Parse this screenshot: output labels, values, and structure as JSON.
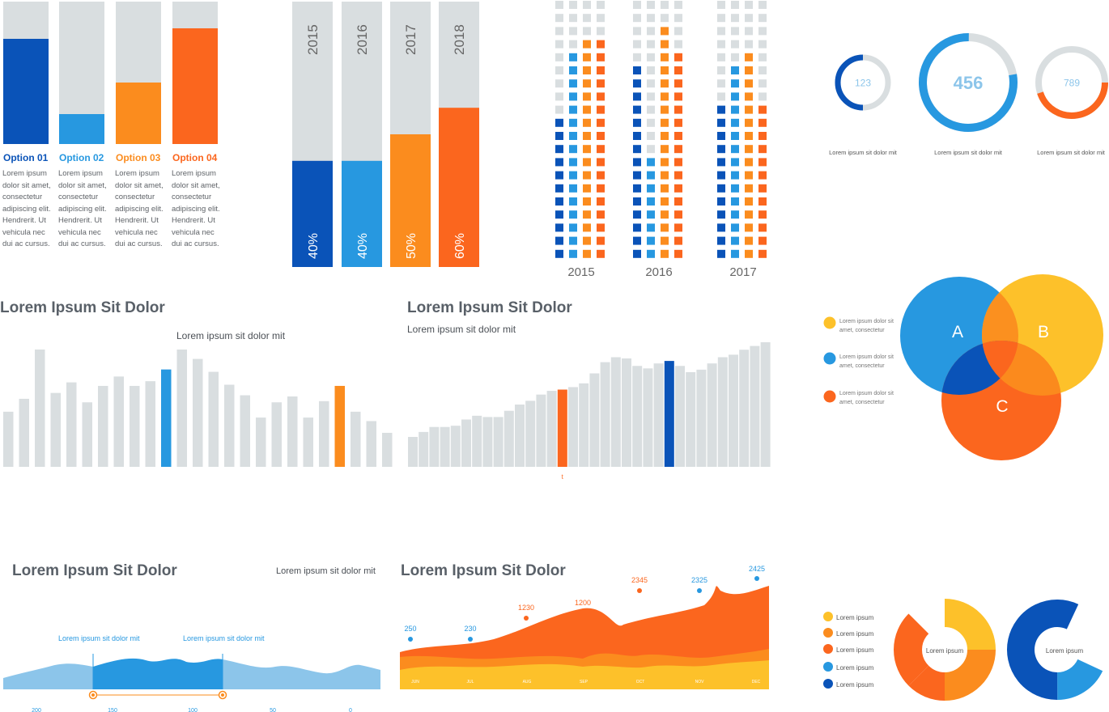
{
  "colors": {
    "dark_blue": "#0a53b8",
    "light_blue": "#2798e0",
    "orange": "#fb8c1e",
    "red_orange": "#fb661e",
    "yellow": "#fdc12a",
    "grey": "#d9dee0",
    "area_light": "#8cc5ea"
  },
  "options": [
    {
      "label": "Option 01",
      "text": "Lorem ipsum dolor sit amet, consectetur adipiscing elit. Hendrerit. Ut vehicula nec dui ac cursus.",
      "value": 0.74,
      "color": "#0a53b8"
    },
    {
      "label": "Option 02",
      "text": "Lorem ipsum dolor sit amet, consectetur adipiscing elit. Hendrerit. Ut vehicula nec dui ac cursus.",
      "value": 0.21,
      "color": "#2798e0"
    },
    {
      "label": "Option 03",
      "text": "Lorem ipsum dolor sit amet, consectetur adipiscing elit. Hendrerit. Ut vehicula nec dui ac cursus.",
      "value": 0.43,
      "color": "#fb8c1e"
    },
    {
      "label": "Option 04",
      "text": "Lorem ipsum dolor sit amet, consectetur adipiscing elit. Hendrerit. Ut vehicula nec dui ac cursus.",
      "value": 0.81,
      "color": "#fb661e"
    }
  ],
  "chart_data": [
    {
      "type": "bar",
      "categories": [
        "2015",
        "2016",
        "2017",
        "2018"
      ],
      "values": [
        40,
        40,
        50,
        60
      ],
      "value_labels": [
        "40%",
        "40%",
        "50%",
        "60%"
      ],
      "colors": [
        "#0a53b8",
        "#2798e0",
        "#fb8c1e",
        "#fb661e"
      ]
    },
    {
      "type": "bar",
      "subtype": "pictogram",
      "categories": [
        "2015",
        "2016",
        "2017"
      ],
      "rows": 20,
      "columns": 4,
      "filled": [
        [
          11,
          16,
          17,
          17
        ],
        [
          15,
          8,
          18,
          16
        ],
        [
          12,
          15,
          16,
          12
        ]
      ],
      "colors": [
        "#0a53b8",
        "#2798e0",
        "#fb8c1e",
        "#fb661e"
      ]
    },
    {
      "type": "pie",
      "subtype": "ring",
      "rings": [
        {
          "value_label": "123",
          "fraction": 0.5,
          "color": "#0a53b8",
          "caption": "Lorem ipsum sit dolor mit"
        },
        {
          "value_label": "456",
          "fraction": 0.78,
          "color": "#2798e0",
          "caption": "Lorem ipsum sit dolor mit"
        },
        {
          "value_label": "789",
          "fraction": 0.45,
          "color": "#fb661e",
          "caption": "Lorem ipsum sit dolor mit"
        }
      ]
    },
    {
      "type": "bar",
      "title": "Lorem Ipsum Sit Dolor",
      "annotation": "Lorem ipsum sit dolor mit",
      "values": [
        0.47,
        0.58,
        1.0,
        0.63,
        0.72,
        0.55,
        0.69,
        0.77,
        0.69,
        0.73,
        0.83,
        1.0,
        0.92,
        0.81,
        0.7,
        0.61,
        0.42,
        0.55,
        0.6,
        0.42,
        0.56,
        0.69,
        0.47,
        0.39,
        0.29
      ],
      "highlight": {
        "10": "#2798e0",
        "21": "#fb8c1e"
      }
    },
    {
      "type": "bar",
      "title": "Lorem Ipsum Sit Dolor",
      "subtitle": "Lorem ipsum sit dolor mit",
      "marker_label": "t",
      "values": [
        0.24,
        0.28,
        0.32,
        0.32,
        0.33,
        0.38,
        0.41,
        0.4,
        0.4,
        0.45,
        0.5,
        0.53,
        0.58,
        0.61,
        0.62,
        0.64,
        0.67,
        0.75,
        0.84,
        0.88,
        0.87,
        0.81,
        0.79,
        0.83,
        0.85,
        0.81,
        0.76,
        0.78,
        0.83,
        0.88,
        0.9,
        0.94,
        0.97,
        1.0
      ],
      "highlight": {
        "14": "#fb661e",
        "24": "#0a53b8"
      }
    },
    {
      "type": "other",
      "subtype": "venn",
      "sets": [
        {
          "label": "A",
          "color": "#2798e0",
          "legend": "Lorem ipsum dolor sit amet, consectetur"
        },
        {
          "label": "B",
          "color": "#fdc12a",
          "legend": "Lorem ipsum dolor sit amet, consectetur"
        },
        {
          "label": "C",
          "color": "#fb661e",
          "legend": "Lorem ipsum dolor sit amet, consectetur"
        }
      ]
    },
    {
      "type": "area",
      "title": "Lorem Ipsum Sit Dolor",
      "annotation": "Lorem ipsum sit dolor mit",
      "marker_labels": [
        "Lorem ipsum sit dolor mit",
        "Lorem ipsum sit dolor mit"
      ],
      "x_ticks": [
        "200",
        "150",
        "100",
        "50",
        "0"
      ],
      "xlim": [
        200,
        0
      ],
      "highlight_range": [
        165,
        85
      ]
    },
    {
      "type": "area",
      "title": "Lorem Ipsum Sit Dolor",
      "categories": [
        "JUN",
        "JUL",
        "AUG",
        "SEP",
        "OCT",
        "NOV",
        "DEC"
      ],
      "points": [
        {
          "label": "250",
          "color": "#2798e0"
        },
        {
          "label": "230",
          "color": "#2798e0"
        },
        {
          "label": "1230",
          "color": "#fb661e"
        },
        {
          "label": "1200",
          "color": "#fb661e"
        },
        {
          "label": "2345",
          "color": "#fb661e"
        },
        {
          "label": "2325",
          "color": "#2798e0"
        },
        {
          "label": "2425",
          "color": "#2798e0"
        }
      ],
      "series_colors": [
        "#fb661e",
        "#fb8c1e",
        "#fdc12a"
      ]
    },
    {
      "type": "pie",
      "subtype": "donut",
      "center_label": "Lorem ipsum",
      "slices": [
        {
          "name": "Lorem ipsum",
          "color": "#fdc12a",
          "value": 25
        },
        {
          "name": "Lorem ipsum",
          "color": "#fb8c1e",
          "value": 25
        },
        {
          "name": "Lorem ipsum",
          "color": "#fb661e",
          "value": 12.5
        },
        {
          "name": "Lorem ipsum",
          "color": "#fb661e",
          "value": 25
        }
      ]
    },
    {
      "type": "pie",
      "subtype": "donut",
      "center_label": "Lorem ipsum",
      "slices": [
        {
          "name": "Lorem ipsum",
          "color": "#2798e0",
          "value": 18
        },
        {
          "name": "Lorem ipsum",
          "color": "#0a53b8",
          "value": 57
        }
      ]
    }
  ],
  "pie_legend": [
    {
      "label": "Lorem ipsum",
      "color": "#fdc12a"
    },
    {
      "label": "Lorem ipsum",
      "color": "#fb8c1e"
    },
    {
      "label": "Lorem ipsum",
      "color": "#fb661e"
    },
    {
      "label": "Lorem ipsum",
      "color": "#2798e0"
    },
    {
      "label": "Lorem ipsum",
      "color": "#0a53b8"
    }
  ]
}
